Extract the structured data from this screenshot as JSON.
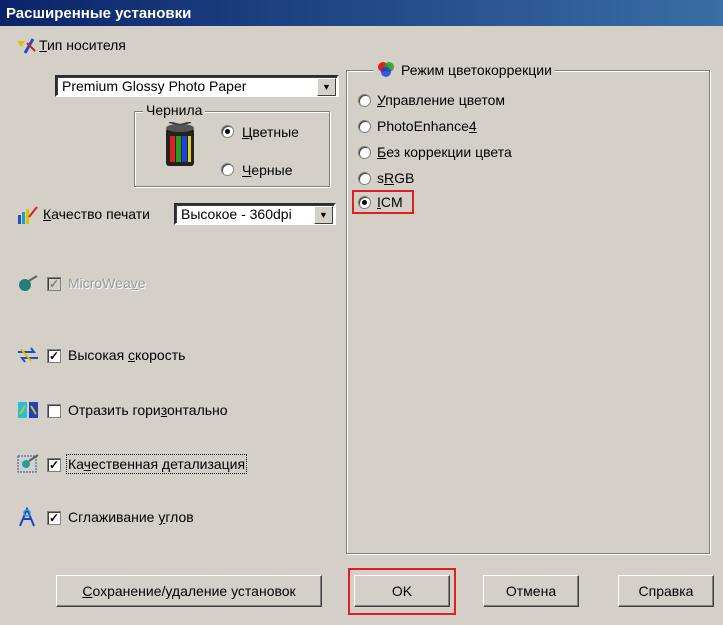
{
  "window": {
    "title": "Расширенные установки"
  },
  "media": {
    "label_prefix": "",
    "label_u": "Т",
    "label_rest": "ип носителя",
    "value": "Premium Glossy Photo Paper"
  },
  "ink": {
    "title": "Чернила",
    "color": {
      "u": "Ц",
      "rest": "ветные",
      "selected": true
    },
    "black": {
      "u": "Ч",
      "rest": "ерные",
      "selected": false
    }
  },
  "quality": {
    "label_u": "К",
    "label_rest": "ачество печати",
    "value": "Высокое - 360dpi"
  },
  "options": {
    "microweave": {
      "pre": "MicroWea",
      "u": "v",
      "post": "e",
      "checked": true,
      "enabled": false
    },
    "high_speed": {
      "pre": "Высокая ",
      "u": "с",
      "post": "корость",
      "checked": true
    },
    "flip": {
      "pre": "Отразить гори",
      "u": "з",
      "post": "онтально",
      "checked": false
    },
    "detail": {
      "pre": "Ка",
      "u": "ч",
      "post": "ественная детализация",
      "checked": true
    },
    "smoothing": {
      "pre": "Сглаживание ",
      "u": "у",
      "post": "глов",
      "checked": true
    }
  },
  "color_mode": {
    "title": "Режим цветокоррекции",
    "items": [
      {
        "pre": "",
        "u": "У",
        "post": "правление цветом",
        "selected": false
      },
      {
        "pre": "PhotoEnhance",
        "u": "4",
        "post": "",
        "selected": false
      },
      {
        "pre": "",
        "u": "Б",
        "post": "ез коррекции цвета",
        "selected": false
      },
      {
        "pre": "s",
        "u": "R",
        "post": "GB",
        "selected": false
      },
      {
        "pre": "",
        "u": "I",
        "post": "CM",
        "selected": true
      }
    ]
  },
  "buttons": {
    "save": {
      "u": "С",
      "rest": "охранение/удаление установок"
    },
    "ok": "OK",
    "cancel": "Отмена",
    "help": "Справка"
  },
  "colors": {
    "highlight": "#e02020",
    "title_start": "#0a246a",
    "title_end": "#3a6ea5"
  }
}
